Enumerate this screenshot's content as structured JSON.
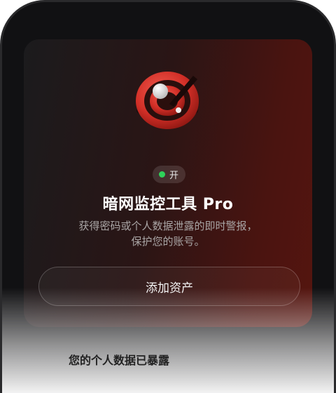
{
  "card": {
    "status_label": "开",
    "title": "暗网监控工具 Pro",
    "description_line1": "获得密码或个人数据泄露的即时警报，",
    "description_line2": "保护您的账号。",
    "add_button_label": "添加资产"
  },
  "below_card": {
    "partial_heading": "您的个人数据已暴露"
  },
  "colors": {
    "status_on": "#2fd35a",
    "logo_red": "#d8302a",
    "card_gradient_end": "#55150f"
  },
  "icons": {
    "logo": "dark-web-monitor-logo-icon",
    "status": "status-dot-icon"
  }
}
